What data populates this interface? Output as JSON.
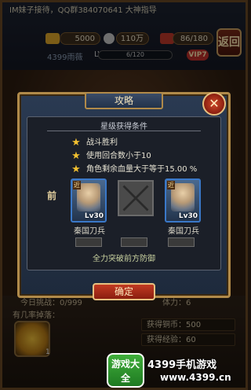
{
  "top": {
    "notice": "IM妹子接待，QQ群384070641 大神指导",
    "gold": "5000",
    "silver": "110万",
    "stamina": "86/180",
    "player_name": "4399雨薇",
    "player_level": "LV3",
    "exp": "6/120",
    "vip": "VIP7",
    "corner_button": "返回"
  },
  "popup": {
    "title": "攻略",
    "close_icon": "close-icon",
    "section_title": "星级获得条件",
    "conditions": [
      "战斗胜利",
      "使用回合数小于10",
      "角色剩余血量大于等于15.00 %"
    ],
    "front_label": "前",
    "units": [
      {
        "level": "Lv30",
        "name": "秦国刀兵",
        "badge": "近"
      },
      {
        "level": "Lv30",
        "name": "秦国刀兵",
        "badge": "近"
      }
    ],
    "tactic": "全力突破前方防御",
    "confirm": "确定"
  },
  "bottom": {
    "today_challenge": "今日挑战：0/999",
    "stamina_cost": "体力：6",
    "drop_label": "有几率掉落：",
    "drop_count": "1",
    "reward_coin": "获得铜币：500",
    "reward_exp": "获得经验：60"
  },
  "watermark": {
    "logo": "游戏大全",
    "text": "4399手机游戏",
    "url": "www.4399.cn"
  },
  "colors": {
    "accent_gold": "#b08a4a",
    "confirm_red": "#c23a22",
    "panel_blue": "#2a3a52"
  }
}
